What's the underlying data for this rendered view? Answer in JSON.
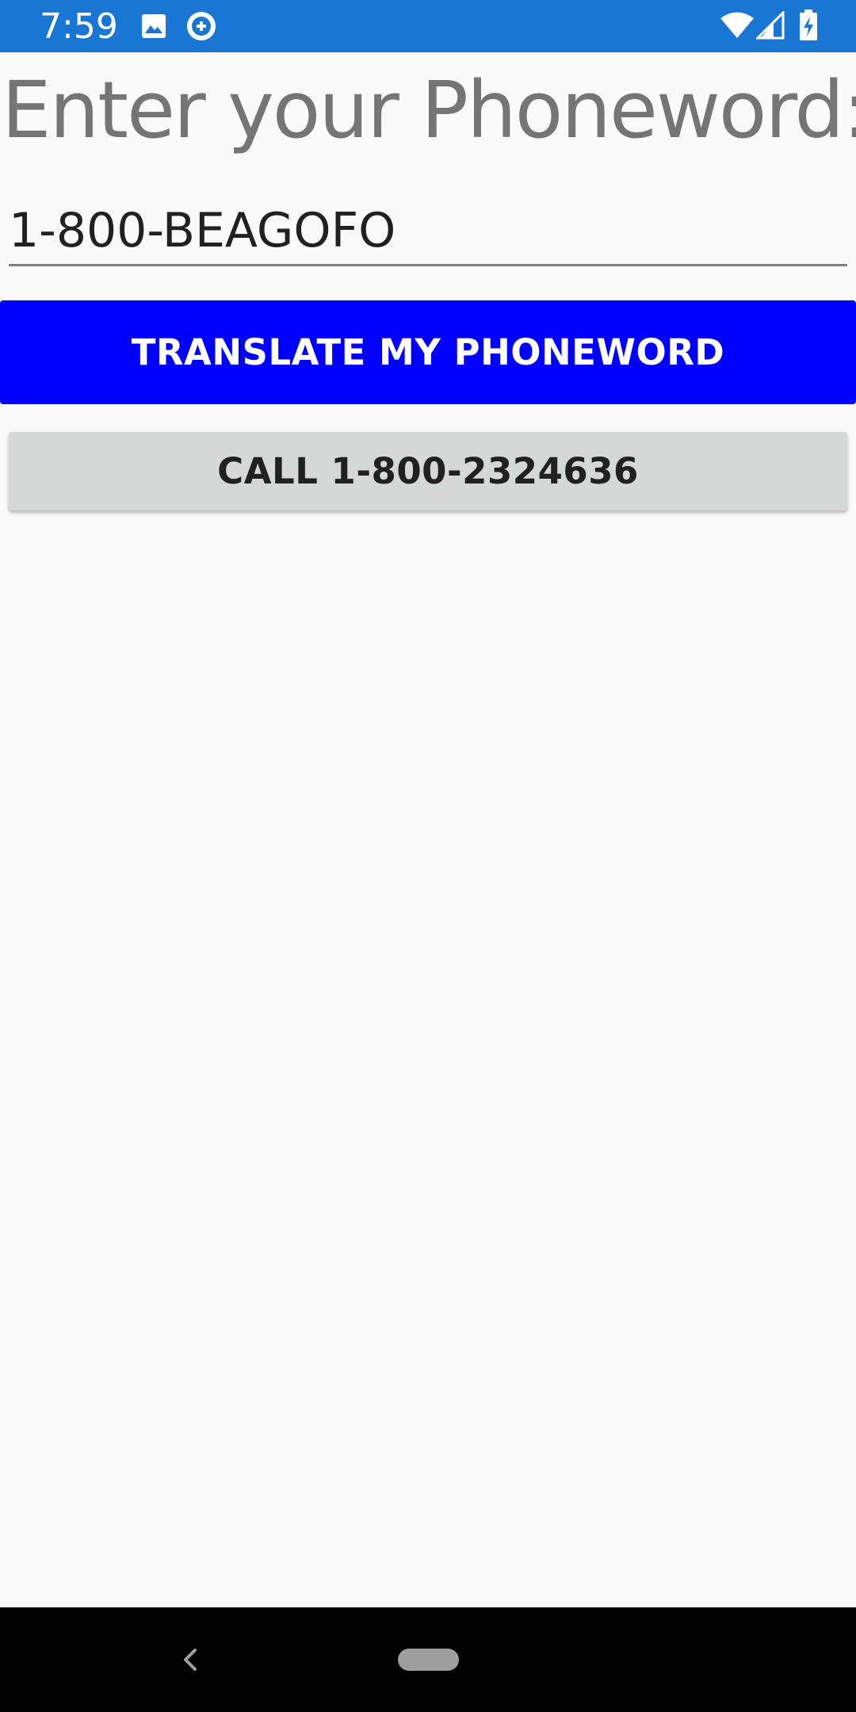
{
  "status_bar": {
    "time": "7:59",
    "background_color": "#1976d2",
    "icons": [
      "image-icon",
      "data-saver-icon",
      "wifi-icon",
      "cell-signal-icon",
      "battery-charging-icon"
    ]
  },
  "main": {
    "prompt": "Enter your Phoneword:",
    "phone_entry": {
      "value": "1-800-BEAGOFO",
      "placeholder": ""
    },
    "translate_button": {
      "label": "TRANSLATE MY PHONEWORD",
      "color": "#0000ff"
    },
    "call_button": {
      "label": "CALL 1-800-2324636",
      "color": "#d6d7d7"
    }
  },
  "nav_bar": {
    "icons": [
      "back-icon",
      "home-pill-icon"
    ]
  }
}
